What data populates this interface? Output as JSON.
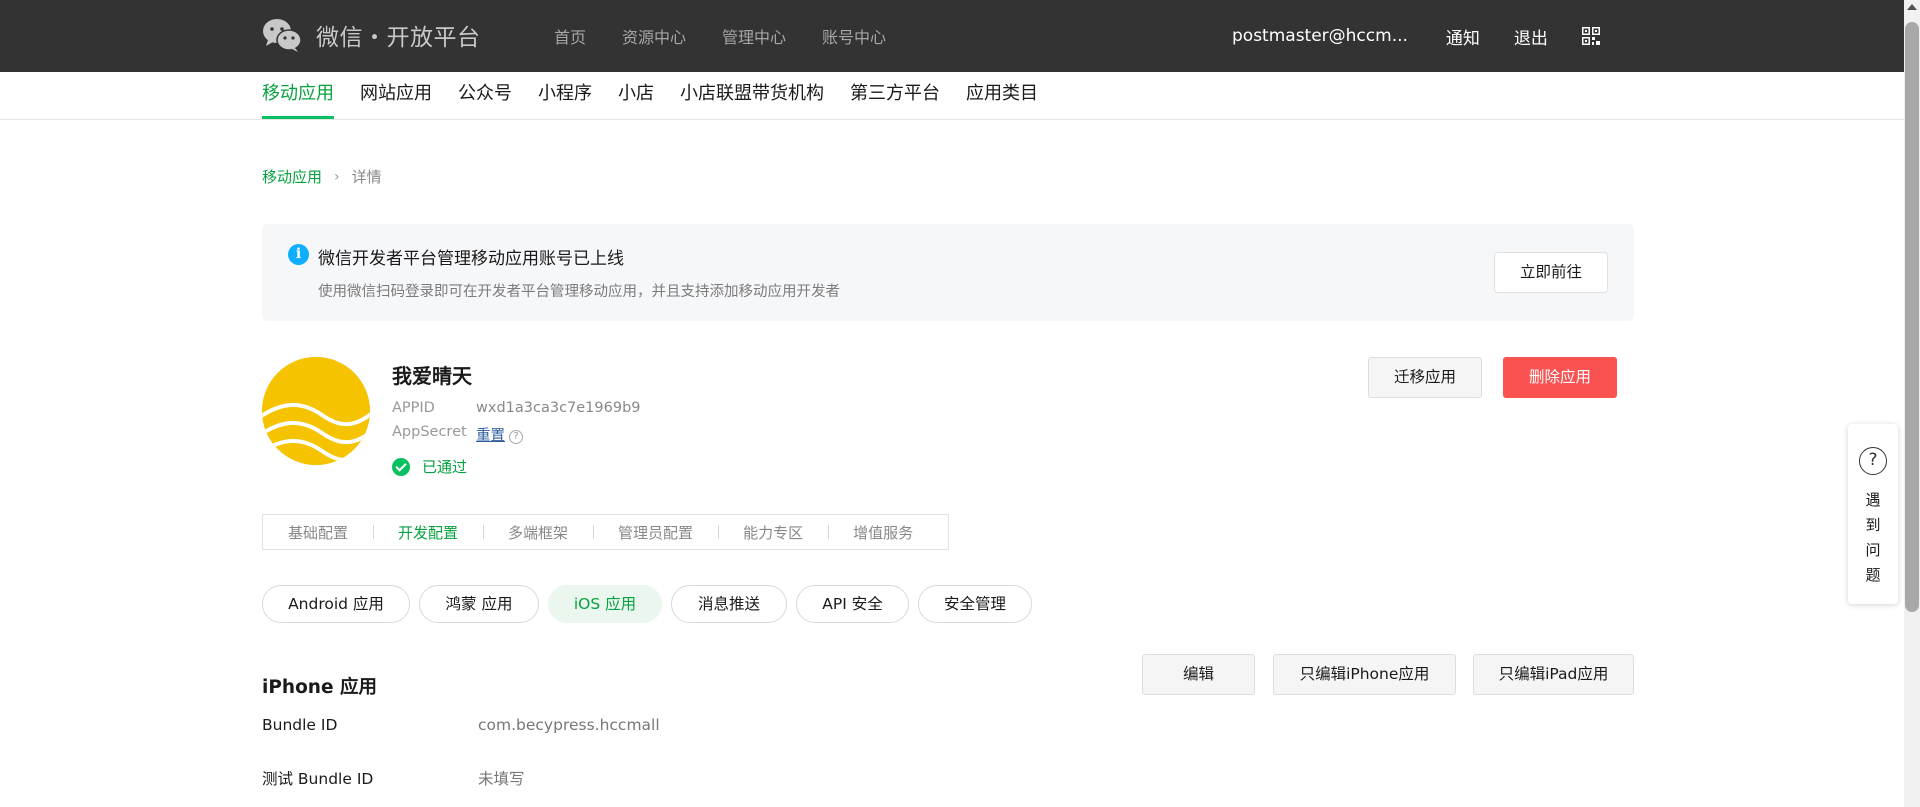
{
  "header": {
    "logo_text": "微信・开放平台",
    "nav": [
      "首页",
      "资源中心",
      "管理中心",
      "账号中心"
    ],
    "user_email": "postmaster@hccm...",
    "notify_label": "通知",
    "logout_label": "退出"
  },
  "category_tabs": [
    "移动应用",
    "网站应用",
    "公众号",
    "小程序",
    "小店",
    "小店联盟带货机构",
    "第三方平台",
    "应用类目"
  ],
  "breadcrumb": {
    "parent": "移动应用",
    "separator": "›",
    "current": "详情"
  },
  "notice": {
    "title": "微信开发者平台管理移动应用账号已上线",
    "subtitle": "使用微信扫码登录即可在开发者平台管理移动应用，并且支持添加移动应用开发者",
    "button": "立即前往"
  },
  "app": {
    "name": "我爱晴天",
    "appid_label": "APPID",
    "appid_value": "wxd1a3ca3c7e1969b9",
    "appsecret_label": "AppSecret",
    "reset_label": "重置",
    "status": "已通过",
    "migrate_button": "迁移应用",
    "delete_button": "删除应用"
  },
  "config_tabs": [
    "基础配置",
    "开发配置",
    "多端框架",
    "管理员配置",
    "能力专区",
    "增值服务"
  ],
  "platform_tabs": [
    "Android 应用",
    "鸿蒙 应用",
    "iOS 应用",
    "消息推送",
    "API 安全",
    "安全管理"
  ],
  "iphone_section": {
    "title": "iPhone 应用",
    "buttons": [
      "编辑",
      "只编辑iPhone应用",
      "只编辑iPad应用"
    ],
    "rows": [
      {
        "label": "Bundle ID",
        "value": "com.becypress.hccmall"
      },
      {
        "label": "测试 Bundle ID",
        "value": "未填写"
      }
    ]
  },
  "help_widget": {
    "text": "遇到问题"
  },
  "colors": {
    "header_bg": "#333333",
    "accent_green": "#07c160",
    "danger_red": "#fa5151",
    "info_blue": "#10aeff",
    "avatar_yellow": "#f5c300"
  }
}
